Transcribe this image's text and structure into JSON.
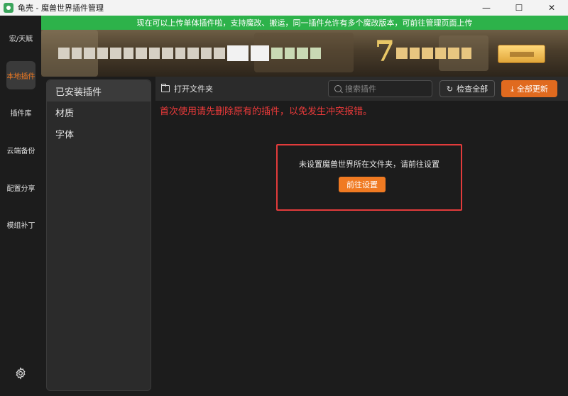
{
  "window": {
    "title": "龟壳 - 魔兽世界插件管理",
    "controls": {
      "minimize": "—",
      "maximize": "☐",
      "close": "✕"
    }
  },
  "rail": {
    "items": [
      {
        "label": "宏/天赋",
        "active": false
      },
      {
        "label": "本地插件",
        "active": true
      },
      {
        "label": "插件库",
        "active": false
      },
      {
        "label": "云端备份",
        "active": false
      },
      {
        "label": "配置分享",
        "active": false
      },
      {
        "label": "模组补丁",
        "active": false
      }
    ],
    "settings_icon": "gear-icon"
  },
  "notice": {
    "text": "现在可以上传单体插件啦，支持魔改、搬运，同一插件允许有多个魔改版本，可前往管理页面上传",
    "color": "#2db24a"
  },
  "banner": {
    "number": "7"
  },
  "categories": {
    "items": [
      {
        "label": "已安装插件",
        "active": true
      },
      {
        "label": "材质",
        "active": false
      },
      {
        "label": "字体",
        "active": false
      }
    ]
  },
  "toolbar": {
    "open_folder_label": "打开文件夹",
    "search_placeholder": "搜索插件",
    "check_all_label": "检查全部",
    "update_all_label": "全部更新",
    "accent": "#e06a1f"
  },
  "main": {
    "warning": "首次使用请先删除原有的插件，以免发生冲突报错。",
    "empty_message": "未设置魔兽世界所在文件夹，请前往设置",
    "goto_settings_label": "前往设置"
  }
}
